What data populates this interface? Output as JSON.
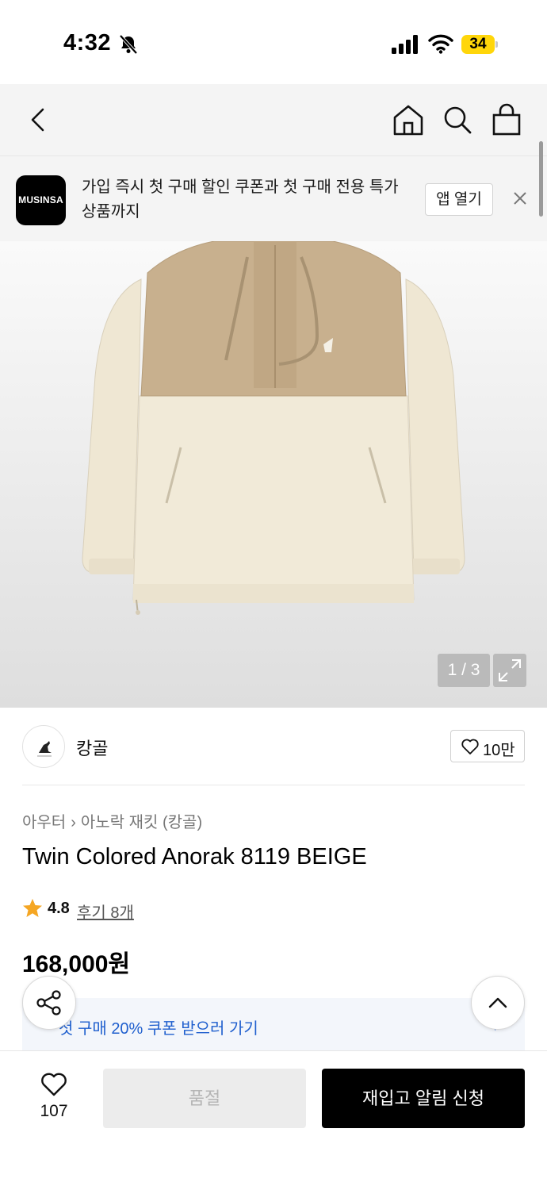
{
  "status_bar": {
    "time": "4:32",
    "battery": "34"
  },
  "banner": {
    "logo_text": "MUSINSA",
    "message": "가입 즉시 첫 구매 할인 쿠폰과 첫 구매 전용 특가 상품까지",
    "open_app_label": "앱 열기"
  },
  "gallery": {
    "counter": "1 / 3"
  },
  "brand": {
    "name": "캉골",
    "like_count": "10만"
  },
  "product": {
    "breadcrumb": [
      "아우터",
      "아노락 재킷 (캉골)"
    ],
    "title": "Twin Colored Anorak 8119 BEIGE",
    "rating": "4.8",
    "review_link": "후기 8개",
    "price": "168,000원"
  },
  "coupon": {
    "text": "첫 구매 20% 쿠폰 받으러 가기"
  },
  "bottom_bar": {
    "wish_count": "107",
    "soldout_label": "품절",
    "restock_label": "재입고 알림 신청"
  },
  "colors": {
    "accent_link": "#1f5fce",
    "star": "#f5a623",
    "battery": "#ffd60a"
  }
}
